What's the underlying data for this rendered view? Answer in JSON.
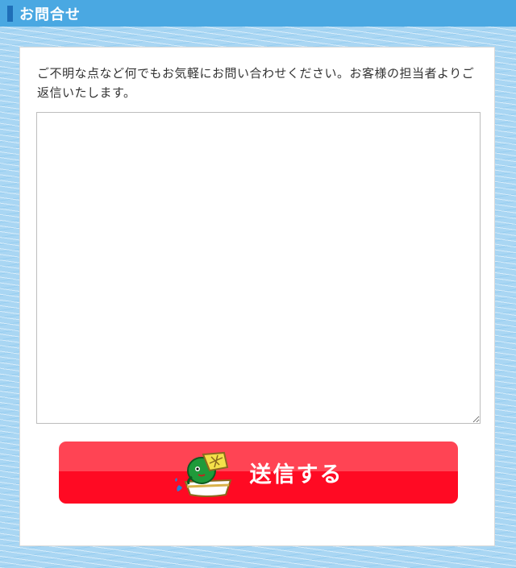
{
  "header": {
    "title": "お問合せ"
  },
  "form": {
    "intro_text": "ご不明な点など何でもお気軽にお問い合わせください。お客様の担当者よりご返信いたします。",
    "message_value": "",
    "submit_label": "送信する",
    "submit_icon": "boat-mascot-icon"
  },
  "colors": {
    "header_bg": "#4aa8e2",
    "header_marker": "#1f6fb8",
    "button_top": "#ff4454",
    "button_bottom": "#ff0a23"
  }
}
